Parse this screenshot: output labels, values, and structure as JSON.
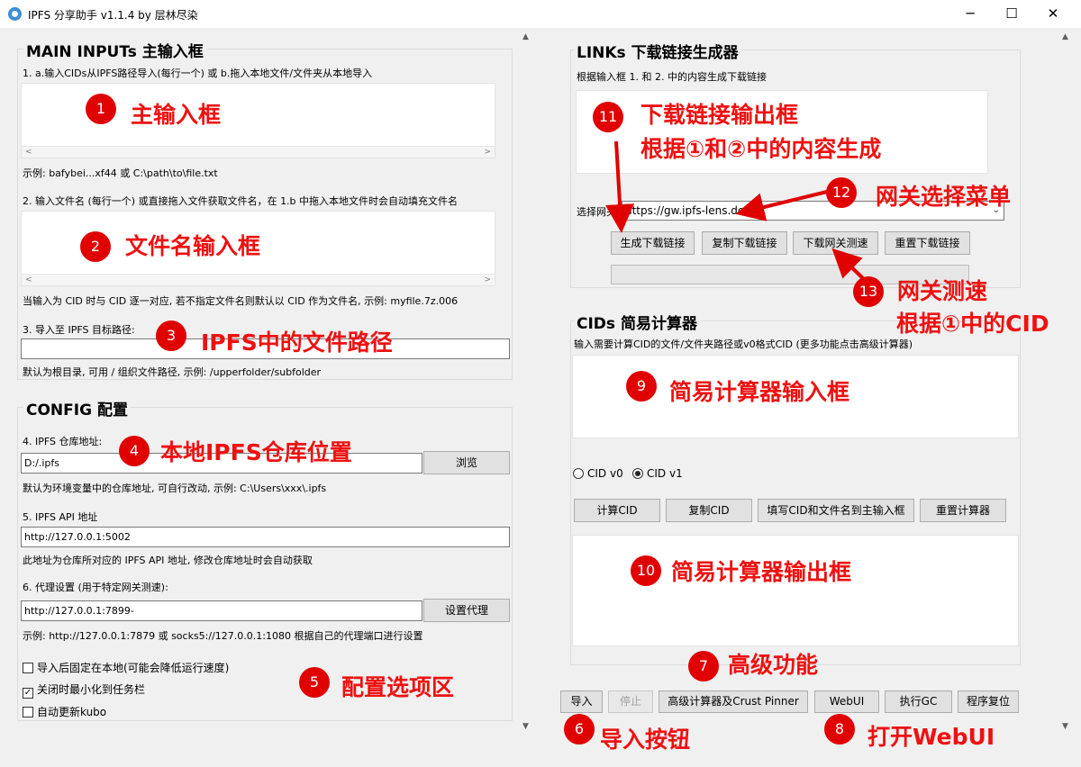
{
  "window": {
    "title": "IPFS 分享助手 v1.1.4 by 层林尽染",
    "minimize_icon": "minimize-icon",
    "maximize_icon": "maximize-icon",
    "close_icon": "close-icon"
  },
  "main_inputs": {
    "title": "MAIN INPUTs 主输入框",
    "label1": "1. a.输入CIDs从IPFS路径导入(每行一个)      或 b.拖入本地文件/文件夹从本地导入",
    "hint1": "示例: bafybei...xf44 或 C:\\path\\to\\file.txt",
    "label2": "2. 输入文件名 (每行一个)      或直接拖入文件获取文件名，在 1.b 中拖入本地文件时会自动填充文件名",
    "hint2": "当输入为 CID 时与 CID 逐一对应, 若不指定文件名则默认以 CID 作为文件名, 示例: myfile.7z.006",
    "label3": "3. 导入至 IPFS 目标路径:",
    "path_value": "",
    "hint3": "默认为根目录, 可用 / 组织文件路径, 示例: /upperfolder/subfolder"
  },
  "config": {
    "title": "CONFIG 配置",
    "label4": "4. IPFS 仓库地址:",
    "repo_value": "D:/.ipfs",
    "browse": "浏览",
    "hint4": "默认为环境变量中的仓库地址, 可自行改动, 示例: C:\\Users\\xxx\\.ipfs",
    "label5": "5. IPFS API 地址",
    "api_value": "http://127.0.0.1:5002",
    "hint5": "此地址为仓库所对应的 IPFS API 地址, 修改仓库地址时会自动获取",
    "label6": "6. 代理设置 (用于特定网关测速):",
    "proxy_value": "http://127.0.0.1:7899-",
    "set_proxy": "设置代理",
    "hint6": "示例: http://127.0.0.1:7879 或 socks5://127.0.0.1:1080 根据自己的代理端口进行设置",
    "checkboxes": [
      {
        "label": "导入后固定在本地(可能会降低运行速度)",
        "checked": false
      },
      {
        "label": "关闭时最小化到任务栏",
        "checked": true
      },
      {
        "label": "自动更新kubo",
        "checked": false
      }
    ],
    "check_mark": "✓"
  },
  "links": {
    "title": "LINKs 下载链接生成器",
    "desc": "根据输入框 1. 和 2. 中的内容生成下载链接",
    "gateway_label": "选择网关",
    "gateway_value": "https://gw.ipfs-lens.dev",
    "buttons": [
      "生成下载链接",
      "复制下载链接",
      "下载网关测速",
      "重置下载链接"
    ]
  },
  "cids": {
    "title": "CIDs 简易计算器",
    "desc": "输入需要计算CID的文件/文件夹路径或v0格式CID (更多功能点击高级计算器)",
    "radio_v0": "CID v0",
    "radio_v1": "CID v1",
    "selected": "v1",
    "buttons": [
      "计算CID",
      "复制CID",
      "填写CID和文件名到主输入框",
      "重置计算器"
    ]
  },
  "bottom_buttons": [
    {
      "label": "导入",
      "enabled": true
    },
    {
      "label": "停止",
      "enabled": false
    },
    {
      "label": "高级计算器及Crust Pinner",
      "enabled": true
    },
    {
      "label": "WebUI",
      "enabled": true
    },
    {
      "label": "执行GC",
      "enabled": true
    },
    {
      "label": "程序复位",
      "enabled": true
    }
  ],
  "annotations": {
    "n1": "1",
    "t1": "主输入框",
    "n2": "2",
    "t2": "文件名输入框",
    "n3": "3",
    "t3": "IPFS中的文件路径",
    "n4": "4",
    "t4": "本地IPFS仓库位置",
    "n5": "5",
    "t5": "配置选项区",
    "n6": "6",
    "t6": "导入按钮",
    "n7": "7",
    "t7": "高级功能",
    "n8": "8",
    "t8": "打开WebUI",
    "n9": "9",
    "t9": "简易计算器输入框",
    "n10": "10",
    "t10": "简易计算器输出框",
    "n11": "11",
    "t11a": "下载链接输出框",
    "t11b": "根据①和②中的内容生成",
    "n12": "12",
    "t12": "网关选择菜单",
    "n13": "13",
    "t13a": "网关测速",
    "t13b": "根据①中的CID"
  },
  "icons": {
    "scroll_up": "▲",
    "scroll_down": "▼",
    "scroll_left": "<",
    "scroll_right": ">",
    "combo_arrow": "⌄"
  }
}
